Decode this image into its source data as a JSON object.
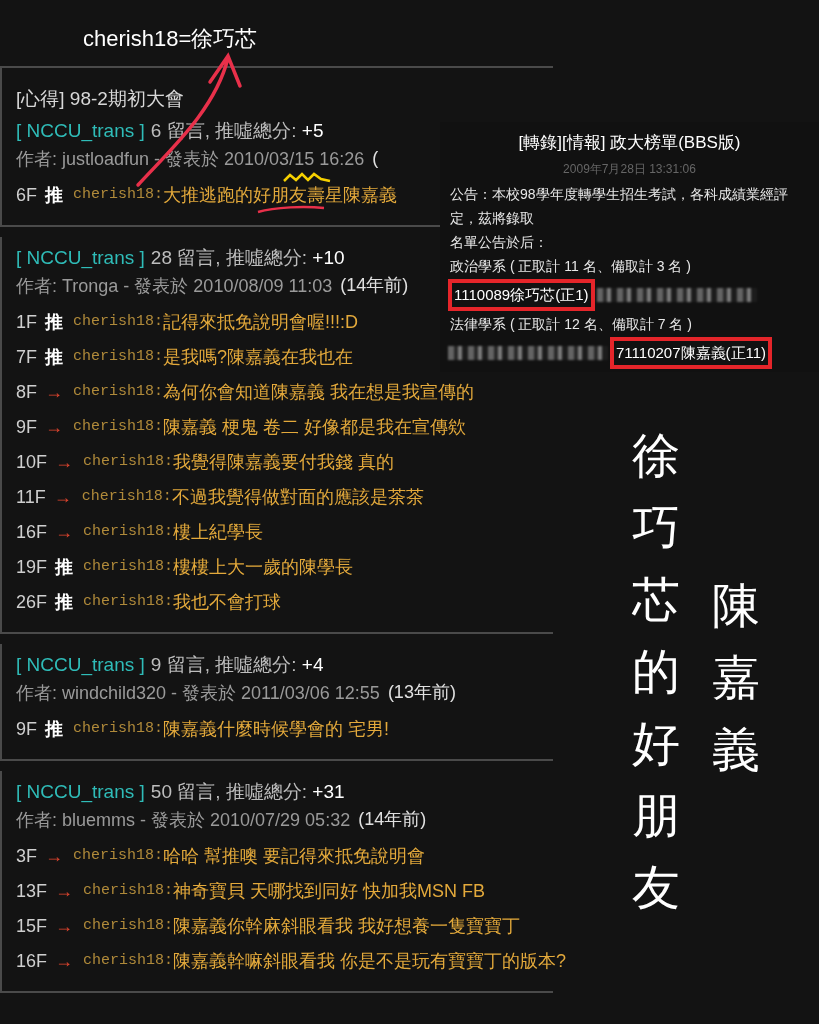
{
  "annotation": "cherish18=徐巧芯",
  "threads": [
    {
      "title": "[心得] 98-2期初大會",
      "board": "[ NCCU_trans ]",
      "count": "6 留言, 推噓總分: ",
      "score": "+5",
      "author": "作者: justloadfun - 發表於 2010/03/15 16:26",
      "age": "(",
      "comments": [
        {
          "floor": "6F",
          "kind": "push",
          "tag": "推",
          "user": "cherish18:",
          "text": "大推逃跑的好朋友壽星陳嘉義"
        }
      ]
    },
    {
      "board": "[ NCCU_trans ]",
      "count": "28 留言, 推噓總分: ",
      "score": "+10",
      "author": "作者: Tronga - 發表於 2010/08/09 11:03",
      "age": "(14年前)",
      "comments": [
        {
          "floor": "1F",
          "kind": "push",
          "tag": "推",
          "user": "cherish18:",
          "text": "記得來抵免說明會喔!!!:D"
        },
        {
          "floor": "7F",
          "kind": "push",
          "tag": "推",
          "user": "cherish18:",
          "text": "是我嗎?陳嘉義在我也在"
        },
        {
          "floor": "8F",
          "kind": "arrow",
          "tag": "→",
          "user": "cherish18:",
          "text": "為何你會知道陳嘉義 我在想是我宣傳的"
        },
        {
          "floor": "9F",
          "kind": "arrow",
          "tag": "→",
          "user": "cherish18:",
          "text": "陳嘉義 梗鬼 卷二 好像都是我在宣傳欸"
        },
        {
          "floor": "10F",
          "kind": "arrow",
          "tag": "→",
          "user": "cherish18:",
          "text": "我覺得陳嘉義要付我錢 真的"
        },
        {
          "floor": "11F",
          "kind": "arrow",
          "tag": "→",
          "user": "cherish18:",
          "text": "不過我覺得做對面的應該是茶茶"
        },
        {
          "floor": "16F",
          "kind": "arrow",
          "tag": "→",
          "user": "cherish18:",
          "text": "樓上紀學長"
        },
        {
          "floor": "19F",
          "kind": "push",
          "tag": "推",
          "user": "cherish18:",
          "text": "樓樓上大一歲的陳學長"
        },
        {
          "floor": "26F",
          "kind": "push",
          "tag": "推",
          "user": "cherish18:",
          "text": "我也不會打球"
        }
      ]
    },
    {
      "board": "[ NCCU_trans ]",
      "count": "9 留言, 推噓總分: ",
      "score": "+4",
      "author": "作者: windchild320 - 發表於 2011/03/06 12:55",
      "age": "(13年前)",
      "comments": [
        {
          "floor": "9F",
          "kind": "push",
          "tag": "推",
          "user": "cherish18:",
          "text": "陳嘉義什麼時候學會的 宅男!"
        }
      ]
    },
    {
      "board": "[ NCCU_trans ]",
      "count": "50 留言, 推噓總分: ",
      "score": "+31",
      "author": "作者: bluemms - 發表於 2010/07/29 05:32",
      "age": "(14年前)",
      "comments": [
        {
          "floor": "3F",
          "kind": "arrow",
          "tag": "→",
          "user": "cherish18:",
          "text": "哈哈 幫推噢 要記得來抵免說明會"
        },
        {
          "floor": "13F",
          "kind": "arrow",
          "tag": "→",
          "user": "cherish18:",
          "text": "神奇寶貝 天哪找到同好 快加我MSN FB"
        },
        {
          "floor": "15F",
          "kind": "arrow",
          "tag": "→",
          "user": "cherish18:",
          "text": "陳嘉義你幹麻斜眼看我 我好想養一隻寶寶丁"
        },
        {
          "floor": "16F",
          "kind": "arrow",
          "tag": "→",
          "user": "cherish18:",
          "text": "陳嘉義幹嘛斜眼看我 你是不是玩有寶寶丁的版本?"
        }
      ]
    }
  ],
  "notice": {
    "title": "[轉錄][情報] 政大榜單(BBS版)",
    "date": "2009年7月28日 13:31:06",
    "lines": [
      {
        "kind": "text",
        "text": "公告：本校98學年度轉學生招生考試，各科成績業經評定，茲將錄取"
      },
      {
        "kind": "text",
        "text": "名單公告於后："
      },
      {
        "kind": "text",
        "text": "政治學系 ( 正取計 11 名、備取計 3 名 )"
      },
      {
        "kind": "entry",
        "text": "1110089徐巧芯(正1)",
        "redacted_first": false
      },
      {
        "kind": "text",
        "text": "法律學系 ( 正取計 12 名、備取計 7 名 )"
      },
      {
        "kind": "entry",
        "text": "71110207陳嘉義(正11)",
        "redacted_first": true
      }
    ]
  },
  "vertical_texts": [
    "徐巧芯的好朋友",
    "陳嘉義"
  ]
}
